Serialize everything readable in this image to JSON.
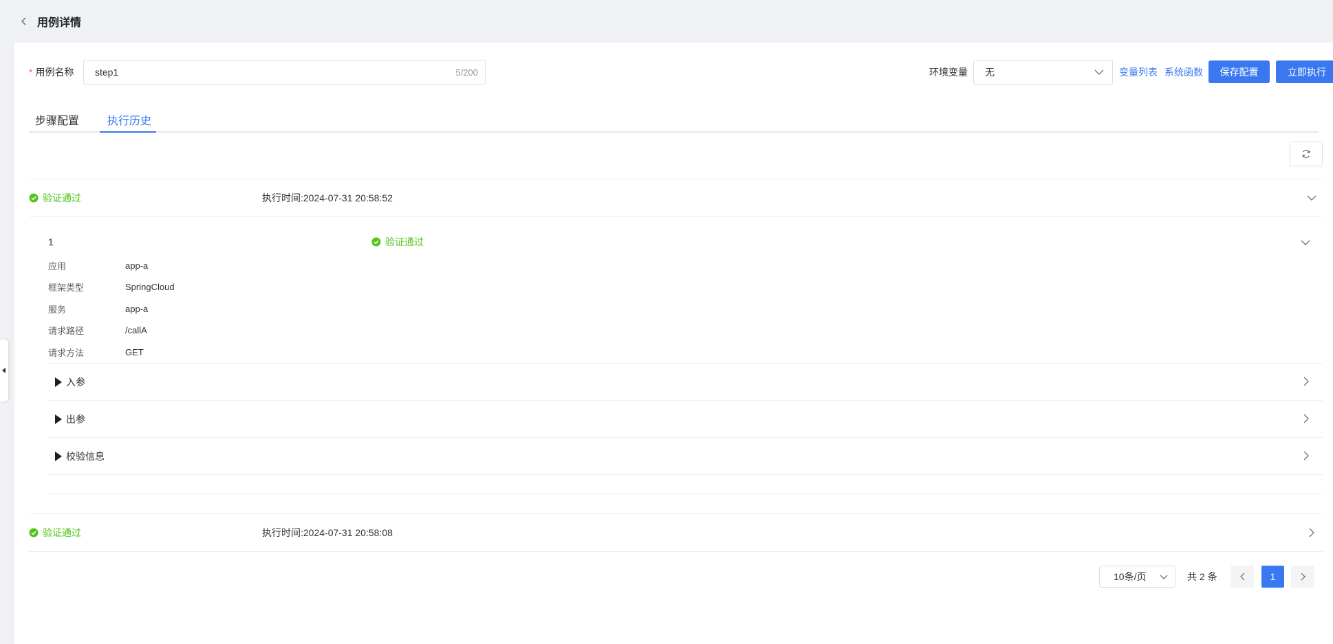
{
  "header": {
    "title": "用例详情"
  },
  "form": {
    "name_label": "用例名称",
    "name_value": "step1",
    "name_count": "5/200",
    "env_label": "环境变量",
    "env_value": "无",
    "var_list_link": "变量列表",
    "sys_func_link": "系统函数",
    "save_button": "保存配置",
    "run_button": "立即执行"
  },
  "tabs": [
    {
      "label": "步骤配置",
      "active": false
    },
    {
      "label": "执行历史",
      "active": true
    }
  ],
  "records": [
    {
      "status": "验证通过",
      "exec_time": "执行时间:2024-07-31 20:58:52",
      "expanded": true,
      "steps": [
        {
          "index": "1",
          "status": "验证通过",
          "details": [
            {
              "key": "应用",
              "value": "app-a"
            },
            {
              "key": "框架类型",
              "value": "SpringCloud"
            },
            {
              "key": "服务",
              "value": "app-a"
            },
            {
              "key": "请求路径",
              "value": "/callA"
            },
            {
              "key": "请求方法",
              "value": "GET"
            }
          ],
          "sections": [
            "入参",
            "出参",
            "校验信息"
          ]
        }
      ]
    },
    {
      "status": "验证通过",
      "exec_time": "执行时间:2024-07-31 20:58:08",
      "expanded": false
    }
  ],
  "pagination": {
    "page_size": "10条/页",
    "total": "共 2 条",
    "current_page": "1"
  },
  "colors": {
    "primary": "#3a78f2",
    "success": "#52c41a",
    "required": "#f56c6c"
  }
}
